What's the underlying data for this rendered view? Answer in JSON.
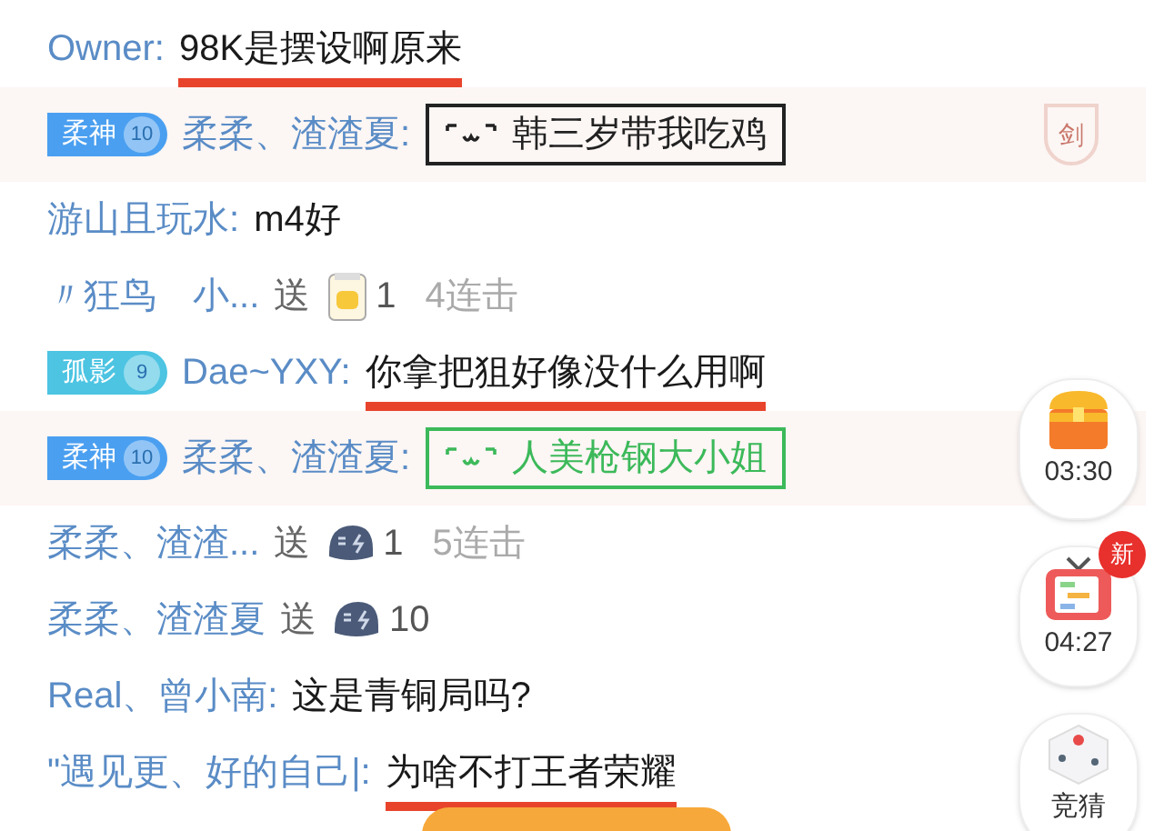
{
  "messages": [
    {
      "kind": "chat",
      "name": "Owner:",
      "text": "98K是摆设啊原来",
      "highlighted": false,
      "underlined": true
    },
    {
      "kind": "chat",
      "badge": {
        "label": "柔神",
        "level": "10",
        "color": "#4a9ff0"
      },
      "name": "柔柔、渣渣夏:",
      "text": "韩三岁带我吃鸡",
      "color": "#222222",
      "highlighted": true,
      "emblem": "剑"
    },
    {
      "kind": "chat",
      "name": "游山且玩水:",
      "text": "m4好",
      "highlighted": false,
      "underlined": false
    },
    {
      "kind": "gift",
      "name": "〃狂鸟　小...",
      "verb": "送",
      "gift": {
        "kind": "bag",
        "count": "1"
      },
      "combo": "4连击"
    },
    {
      "kind": "chat",
      "badge": {
        "label": "孤影",
        "level": "9",
        "color": "#4cc4e2"
      },
      "name": "Dae~YXY:",
      "text": "你拿把狙好像没什么用啊",
      "highlighted": false,
      "underlined": true
    },
    {
      "kind": "chat",
      "badge": {
        "label": "柔神",
        "level": "10",
        "color": "#4a9ff0"
      },
      "name": "柔柔、渣渣夏:",
      "text": "人美枪钢大小姐",
      "color": "#3cb95a",
      "highlighted": true
    },
    {
      "kind": "gift",
      "name": "柔柔、渣渣...",
      "verb": "送",
      "gift": {
        "kind": "helmet",
        "count": "1"
      },
      "combo": "5连击"
    },
    {
      "kind": "gift",
      "name": "柔柔、渣渣夏",
      "verb": "送",
      "gift": {
        "kind": "helmet",
        "count": "10"
      }
    },
    {
      "kind": "chat",
      "name": "Real、曾小南:",
      "text": "这是青铜局吗?",
      "highlighted": false,
      "underlined": false
    },
    {
      "kind": "chat",
      "name": "\"遇见更、好的自己|:",
      "text": "为啥不打王者荣耀",
      "highlighted": false,
      "underlined": true
    }
  ],
  "side_buttons": [
    {
      "kind": "chest",
      "label": "03:30"
    },
    {
      "kind": "tv",
      "label": "04:27",
      "badge": "新"
    },
    {
      "kind": "dice",
      "label": "竞猜"
    }
  ]
}
